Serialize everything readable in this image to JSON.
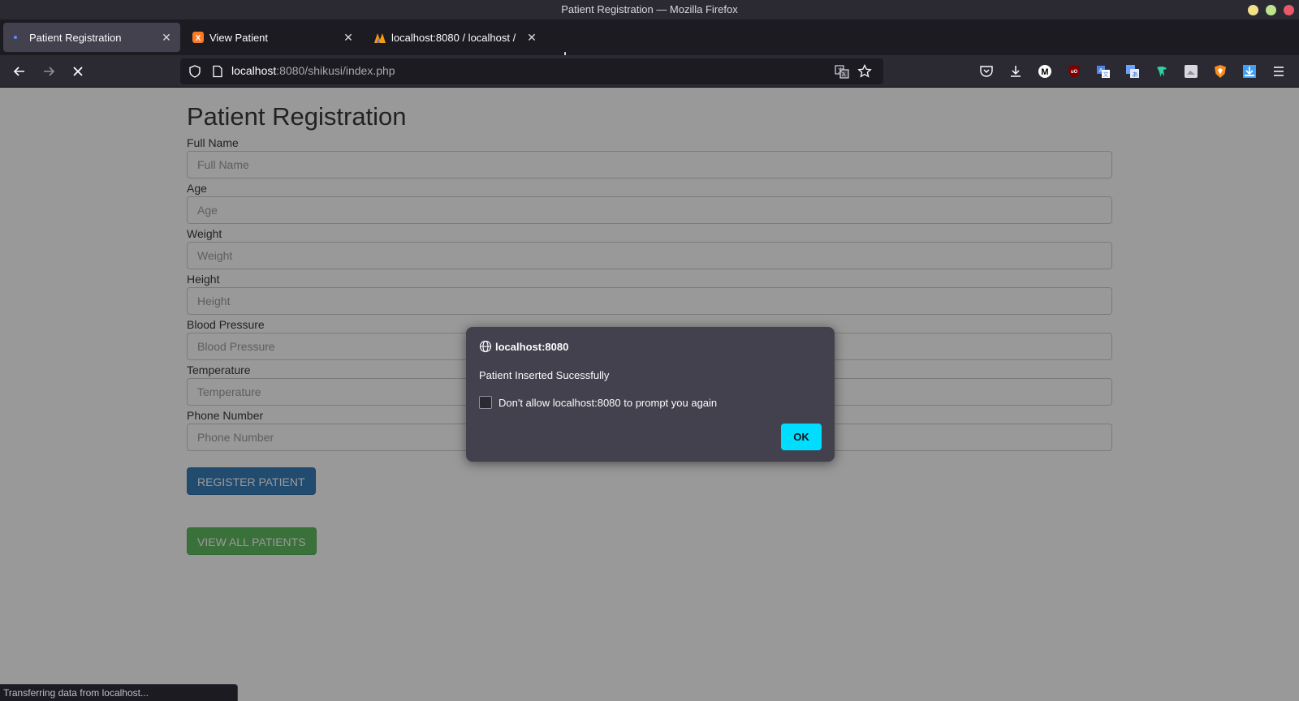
{
  "window": {
    "title": "Patient Registration — Mozilla Firefox",
    "controls": [
      {
        "name": "minimize",
        "color": "#f1e28a"
      },
      {
        "name": "maximize",
        "color": "#bde38f"
      },
      {
        "name": "close",
        "color": "#e9596a"
      }
    ]
  },
  "tabs": [
    {
      "label": "Patient Registration",
      "active": true,
      "icon": "loading-dot-icon"
    },
    {
      "label": "View Patient",
      "active": false,
      "icon": "xampp-icon"
    },
    {
      "label": "localhost:8080 / localhost /",
      "active": false,
      "icon": "phpmyadmin-icon"
    }
  ],
  "navbar": {
    "url_host": "localhost",
    "url_rest": ":8080/shikusi/index.php",
    "extensions": [
      "pocket-icon",
      "downloads-icon",
      "m-extension-icon",
      "ublock-icon",
      "translate-icon",
      "translate-alt-icon",
      "bird-extension-icon",
      "image-extension-icon",
      "brave-shield-icon",
      "download-helper-icon",
      "menu-icon"
    ]
  },
  "page": {
    "title": "Patient Registration",
    "fields": [
      {
        "label": "Full Name",
        "placeholder": "Full Name"
      },
      {
        "label": "Age",
        "placeholder": "Age"
      },
      {
        "label": "Weight",
        "placeholder": "Weight"
      },
      {
        "label": "Height",
        "placeholder": "Height"
      },
      {
        "label": "Blood Pressure",
        "placeholder": "Blood Pressure"
      },
      {
        "label": "Temperature",
        "placeholder": "Temperature"
      },
      {
        "label": "Phone Number",
        "placeholder": "Phone Number"
      }
    ],
    "register_button": "REGISTER PATIENT",
    "view_all_button": "VIEW ALL PATIENTS"
  },
  "dialog": {
    "host": "localhost:8080",
    "message": "Patient Inserted Sucessfully",
    "checkbox_label": "Don't allow localhost:8080 to prompt you again",
    "checked": false,
    "ok_label": "OK"
  },
  "status": {
    "text": "Transferring data from localhost..."
  }
}
